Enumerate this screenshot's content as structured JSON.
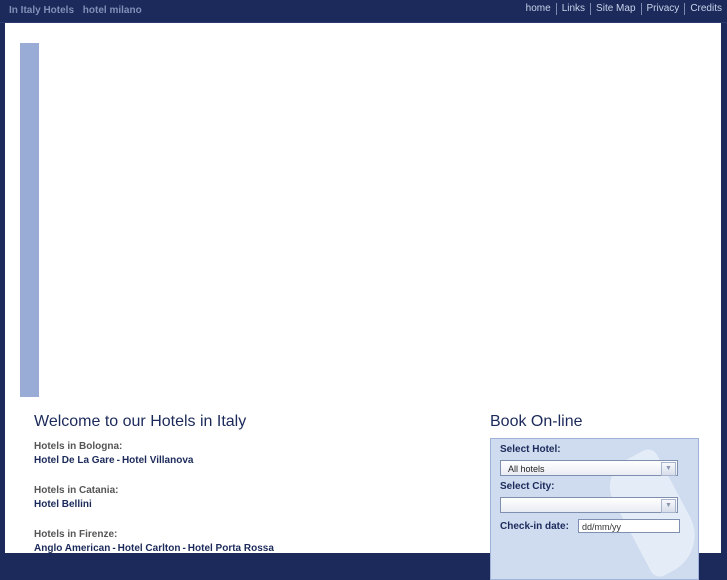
{
  "header": {
    "brand_primary": "In Italy Hotels",
    "brand_secondary": "hotel milano",
    "nav": [
      "home",
      "Links",
      "Site Map",
      "Privacy",
      "Credits"
    ]
  },
  "welcome": {
    "title": "Welcome to our Hotels in Italy",
    "cities": [
      {
        "title": "Hotels in Bologna:",
        "hotels": [
          "Hotel De La Gare",
          "Hotel Villanova"
        ]
      },
      {
        "title": "Hotels in Catania:",
        "hotels": [
          "Hotel Bellini"
        ]
      },
      {
        "title": "Hotels in Firenze:",
        "hotels": [
          "Anglo American",
          "Hotel Carlton",
          "Hotel Porta Rossa"
        ]
      }
    ],
    "separator": "-"
  },
  "booking": {
    "title": "Book On-line",
    "hotel_label": "Select Hotel:",
    "hotel_value": "All hotels",
    "city_label": "Select City:",
    "city_value": "",
    "checkin_label": "Check-in date:",
    "checkin_value": "dd/mm/yy"
  },
  "colors": {
    "header_bg": "#1b2a5a",
    "banner": "#98acd6",
    "link": "#1b2a5a",
    "booking_bg": "#cfdbef"
  }
}
